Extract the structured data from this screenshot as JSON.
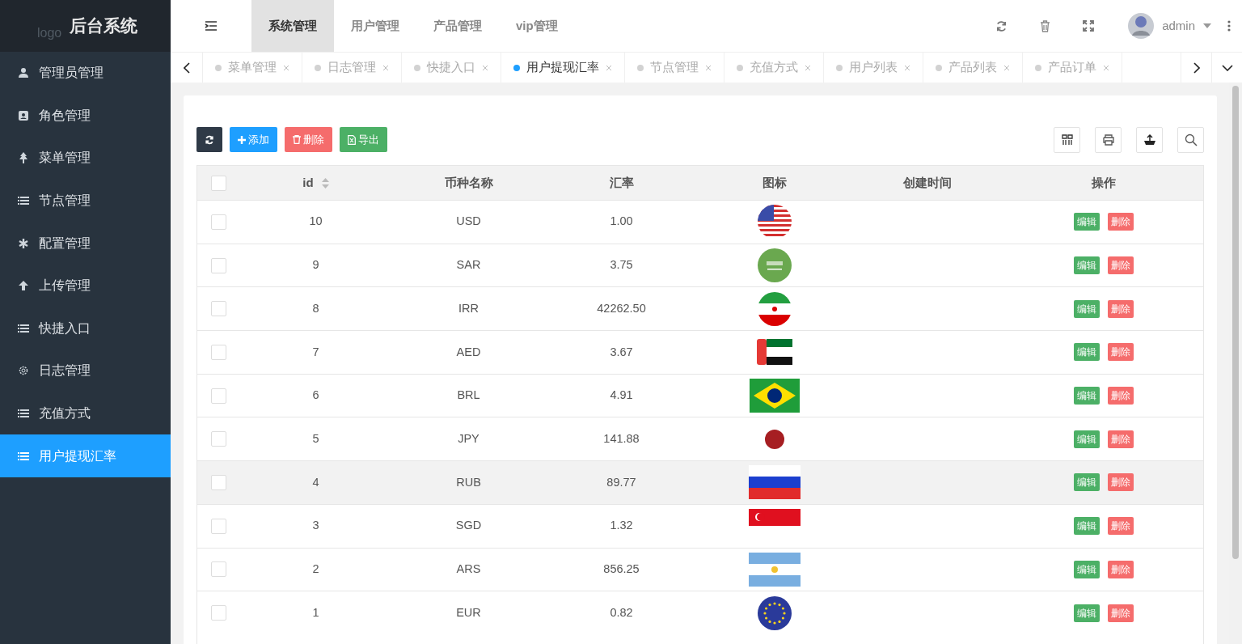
{
  "brand": {
    "logo_alt": "logo",
    "title": "后台系统"
  },
  "sidebar": {
    "items": [
      {
        "label": "管理员管理",
        "kind": "user",
        "selected": false
      },
      {
        "label": "角色管理",
        "kind": "role",
        "selected": false
      },
      {
        "label": "菜单管理",
        "kind": "tree",
        "selected": false
      },
      {
        "label": "节点管理",
        "kind": "list",
        "selected": false
      },
      {
        "label": "配置管理",
        "kind": "asterisk",
        "selected": false
      },
      {
        "label": "上传管理",
        "kind": "upload",
        "selected": false
      },
      {
        "label": "快捷入口",
        "kind": "list",
        "selected": false
      },
      {
        "label": "日志管理",
        "kind": "gear",
        "selected": false
      },
      {
        "label": "充值方式",
        "kind": "list",
        "selected": false
      },
      {
        "label": "用户提现汇率",
        "kind": "list",
        "selected": true
      }
    ]
  },
  "top_tabs": [
    {
      "label": "系统管理",
      "selected": true
    },
    {
      "label": "用户管理",
      "selected": false
    },
    {
      "label": "产品管理",
      "selected": false
    },
    {
      "label": "vip管理",
      "selected": false
    }
  ],
  "user": {
    "name": "admin"
  },
  "open_tabs": [
    {
      "label": "菜单管理",
      "selected": false
    },
    {
      "label": "日志管理",
      "selected": false
    },
    {
      "label": "快捷入口",
      "selected": false
    },
    {
      "label": "用户提现汇率",
      "selected": true
    },
    {
      "label": "节点管理",
      "selected": false
    },
    {
      "label": "充值方式",
      "selected": false
    },
    {
      "label": "用户列表",
      "selected": false
    },
    {
      "label": "产品列表",
      "selected": false
    },
    {
      "label": "产品订单",
      "selected": false
    }
  ],
  "toolbar": {
    "add": "添加",
    "delete": "删除",
    "export": "导出"
  },
  "table": {
    "columns": [
      "id",
      "币种名称",
      "汇率",
      "图标",
      "创建时间",
      "操作"
    ],
    "select_all": {
      "checked": false
    },
    "rows": [
      {
        "id": "10",
        "currency": "USD",
        "rate": "1.00",
        "selected": false,
        "actions": {
          "edit": "编辑",
          "delete": "删除"
        }
      },
      {
        "id": "9",
        "currency": "SAR",
        "rate": "3.75",
        "selected": false,
        "actions": {
          "edit": "编辑",
          "delete": "删除"
        }
      },
      {
        "id": "8",
        "currency": "IRR",
        "rate": "42262.50",
        "selected": false,
        "actions": {
          "edit": "编辑",
          "delete": "删除"
        }
      },
      {
        "id": "7",
        "currency": "AED",
        "rate": "3.67",
        "selected": false,
        "actions": {
          "edit": "编辑",
          "delete": "删除"
        }
      },
      {
        "id": "6",
        "currency": "BRL",
        "rate": "4.91",
        "selected": false,
        "actions": {
          "edit": "编辑",
          "delete": "删除"
        }
      },
      {
        "id": "5",
        "currency": "JPY",
        "rate": "141.88",
        "selected": false,
        "actions": {
          "edit": "编辑",
          "delete": "删除"
        }
      },
      {
        "id": "4",
        "currency": "RUB",
        "rate": "89.77",
        "selected": true,
        "actions": {
          "edit": "编辑",
          "delete": "删除"
        }
      },
      {
        "id": "3",
        "currency": "SGD",
        "rate": "1.32",
        "selected": false,
        "actions": {
          "edit": "编辑",
          "delete": "删除"
        }
      },
      {
        "id": "2",
        "currency": "ARS",
        "rate": "856.25",
        "selected": false,
        "actions": {
          "edit": "编辑",
          "delete": "删除"
        }
      },
      {
        "id": "1",
        "currency": "EUR",
        "rate": "0.82",
        "selected": false,
        "actions": {
          "edit": "编辑",
          "delete": "删除"
        }
      }
    ]
  }
}
